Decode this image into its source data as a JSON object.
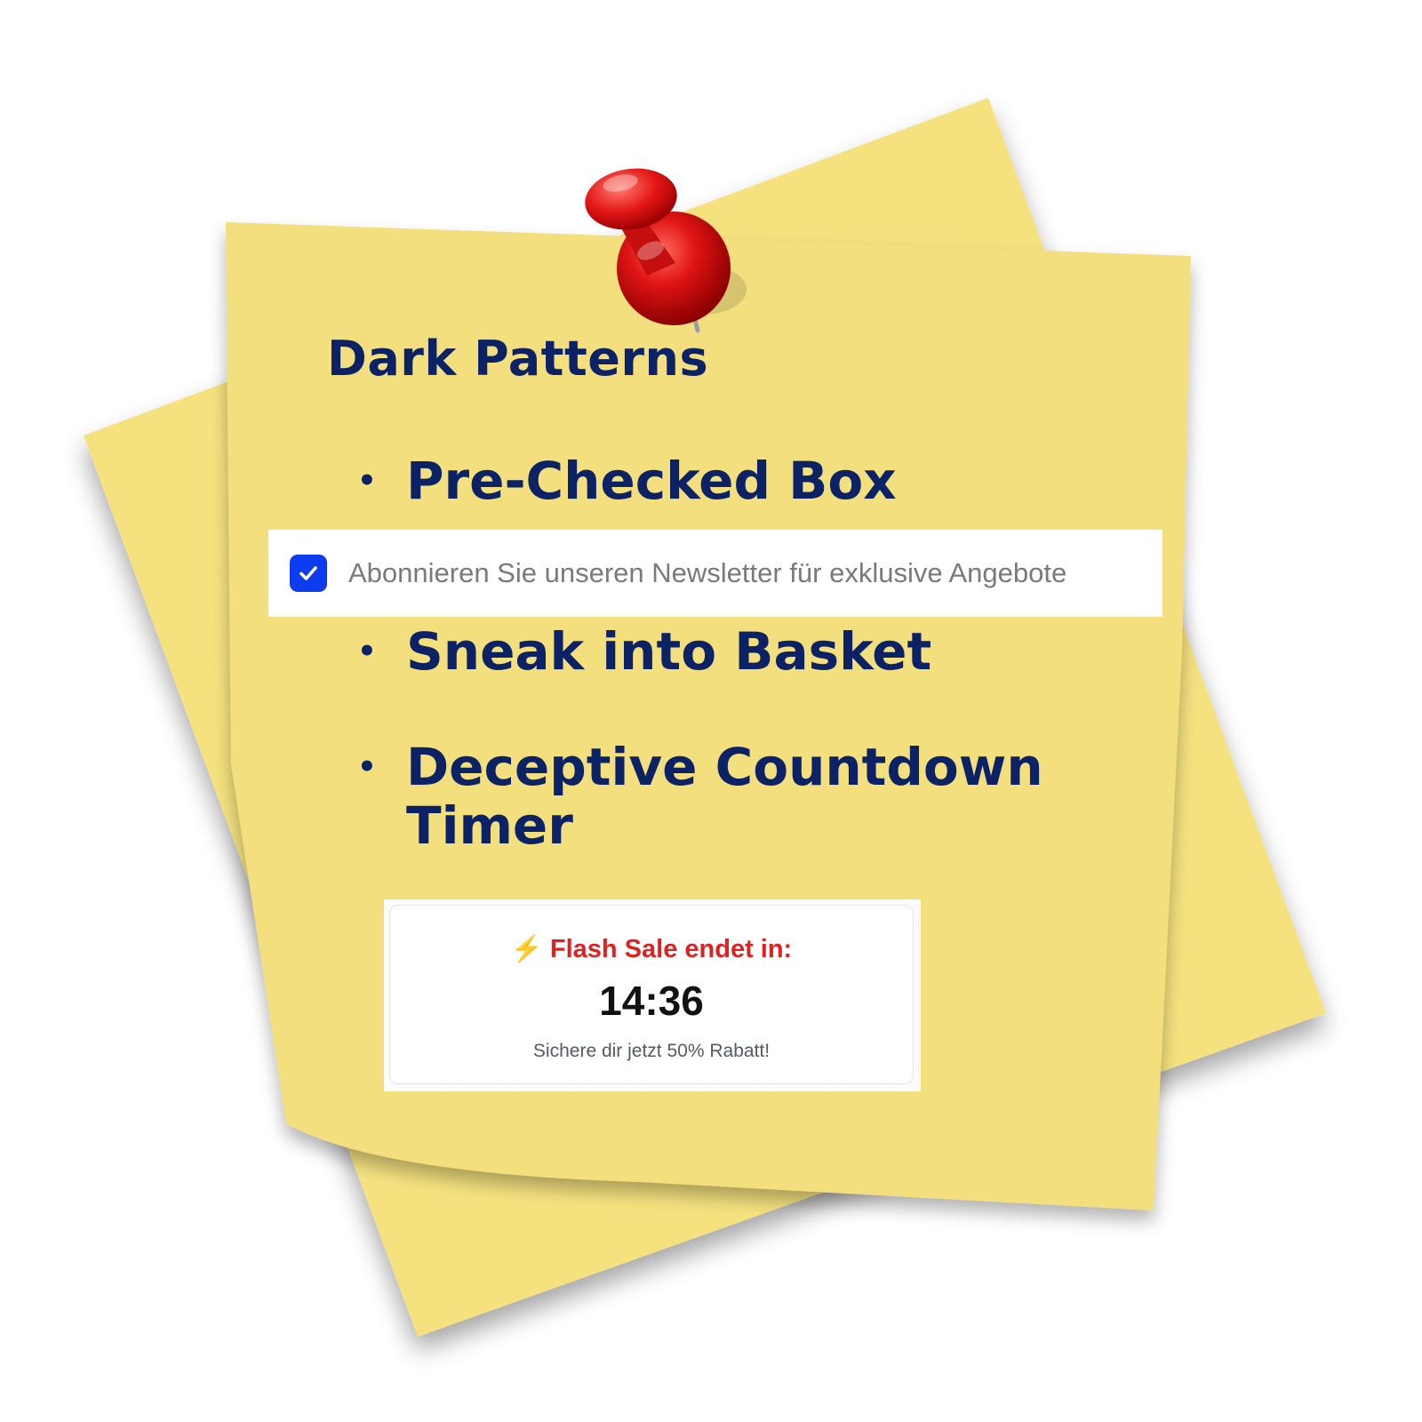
{
  "note": {
    "title": "Dark Patterns",
    "items": [
      {
        "bullet": "•",
        "label": "Pre-Checked Box"
      },
      {
        "bullet": "•",
        "label": "Sneak into Basket"
      },
      {
        "bullet": "•",
        "label": "Deceptive Countdown",
        "label_line2": "Timer"
      }
    ],
    "paper_color": "#f3df7e",
    "back_paper_color": "#f5e27f",
    "text_color": "#0b2266",
    "pin_color": "#d90f0f"
  },
  "newsletter": {
    "checked": true,
    "label": "Abonnieren Sie unseren Newsletter für exklusive Angebote",
    "checkbox_color": "#0d3cf0"
  },
  "flash_sale": {
    "icon": "lightning-bolt-icon",
    "icon_glyph": "⚡",
    "heading": "Flash Sale endet in:",
    "timer": "14:36",
    "subtext": "Sichere dir jetzt 50% Rabatt!",
    "heading_color": "#dd2222"
  }
}
